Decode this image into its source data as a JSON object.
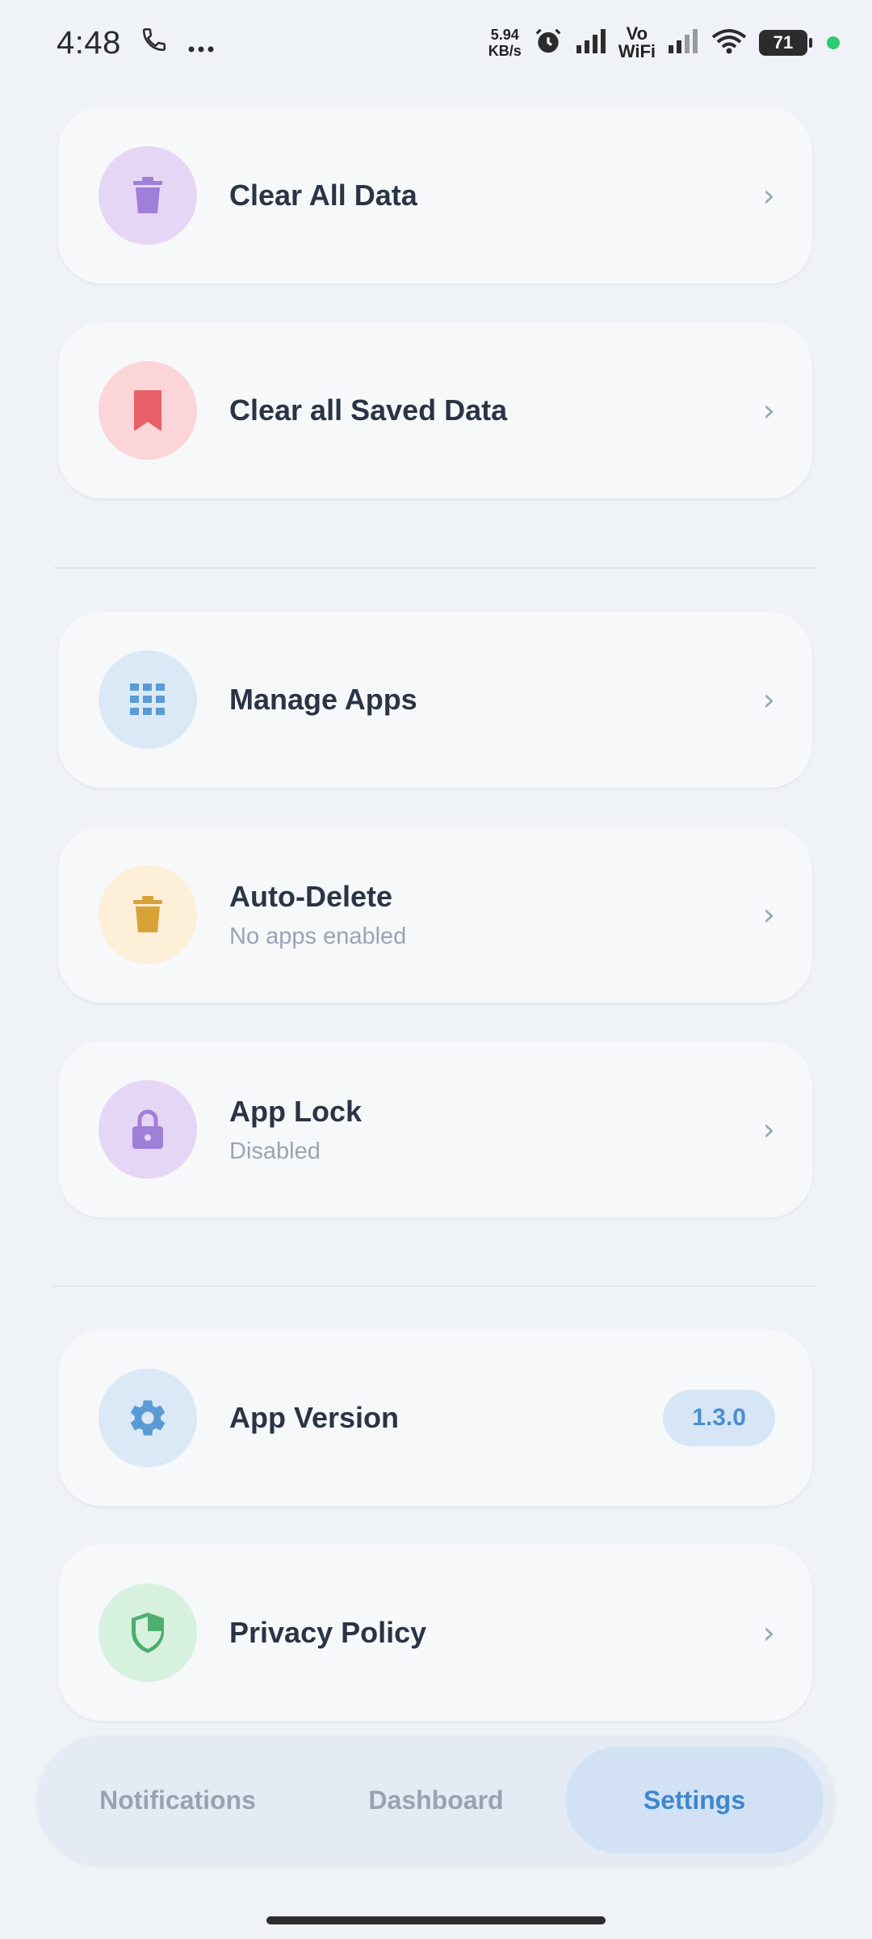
{
  "status_bar": {
    "time": "4:48",
    "net_speed_value": "5.94",
    "net_speed_unit": "KB/s",
    "vowifi_top": "Vo",
    "vowifi_bottom": "WiFi",
    "battery": "71"
  },
  "settings": {
    "clear_all_data": {
      "title": "Clear All Data",
      "icon": "trash-icon",
      "icon_bg": "#e6d6f5",
      "icon_color": "#a07fd9"
    },
    "clear_saved_data": {
      "title": "Clear all Saved Data",
      "icon": "bookmark-icon",
      "icon_bg": "#fbd5d8",
      "icon_color": "#e86169"
    },
    "manage_apps": {
      "title": "Manage Apps",
      "icon": "grid-icon",
      "icon_bg": "#dbe9f6",
      "icon_color": "#5a9bd6"
    },
    "auto_delete": {
      "title": "Auto-Delete",
      "subtitle": "No apps enabled",
      "icon": "trash-icon",
      "icon_bg": "#fdefd8",
      "icon_color": "#d9a236"
    },
    "app_lock": {
      "title": "App Lock",
      "subtitle": "Disabled",
      "icon": "lock-icon",
      "icon_bg": "#e6d6f5",
      "icon_color": "#a07fd9"
    },
    "app_version": {
      "title": "App Version",
      "value": "1.3.0",
      "icon": "gear-icon",
      "icon_bg": "#dbe9f6",
      "icon_color": "#5a9bd6"
    },
    "privacy_policy": {
      "title": "Privacy Policy",
      "icon": "shield-icon",
      "icon_bg": "#d6f1de",
      "icon_color": "#4caf6e"
    },
    "chevron": "›"
  },
  "bottom_nav": {
    "tabs": [
      {
        "label": "Notifications",
        "active": false
      },
      {
        "label": "Dashboard",
        "active": false
      },
      {
        "label": "Settings",
        "active": true
      }
    ]
  }
}
